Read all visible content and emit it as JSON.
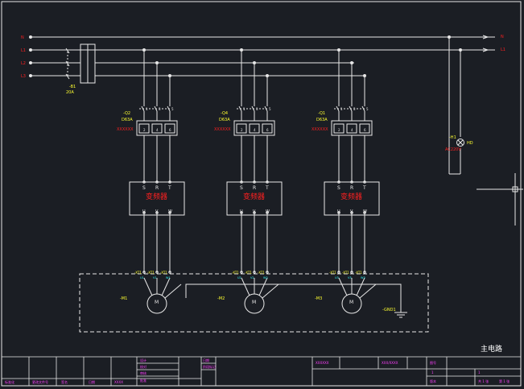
{
  "colors": {
    "background": "#1b1e24",
    "line": "#e8e8e8",
    "label_red": "#ff2020",
    "label_yellow": "#ffff30",
    "label_magenta": "#ff40ff",
    "label_cyan": "#30ffff",
    "label_green": "#30ff30"
  },
  "bus": {
    "left_labels": [
      "N",
      "L1",
      "L2",
      "L3"
    ],
    "right_labels": [
      "N",
      "L1"
    ]
  },
  "main_breaker": {
    "id": "-B1",
    "rating": "20A"
  },
  "drives": [
    {
      "breaker_id": "-Q2",
      "breaker_rating": "D63A",
      "breaker_model": "XXXXXX",
      "contacts": [
        "1",
        "3",
        "5"
      ],
      "contact_bottom": [
        "2",
        "4",
        "6"
      ],
      "vfd_label": "变频器",
      "input_terms": [
        "S",
        "R",
        "T"
      ],
      "output_terms": [
        "U",
        "V",
        "W"
      ],
      "terminal_ids": [
        "-XT1",
        "-XT1",
        "-XT1"
      ],
      "terminal_nums": [
        "U1",
        "V1",
        "W1"
      ],
      "motor_id": "-M1",
      "motor_symbol": "M"
    },
    {
      "breaker_id": "-Q4",
      "breaker_rating": "D63A",
      "breaker_model": "XXXXXX",
      "contacts": [
        "1",
        "3",
        "5"
      ],
      "contact_bottom": [
        "2",
        "4",
        "6"
      ],
      "vfd_label": "变频器",
      "input_terms": [
        "S",
        "R",
        "T"
      ],
      "output_terms": [
        "U",
        "V",
        "W"
      ],
      "terminal_ids": [
        "-XT1",
        "-XT1",
        "-XT1"
      ],
      "terminal_nums": [
        "U2",
        "V2",
        "W2"
      ],
      "motor_id": "-M2",
      "motor_symbol": "M"
    },
    {
      "breaker_id": "-Q1",
      "breaker_rating": "D63A",
      "breaker_model": "XXXXXX",
      "contacts": [
        "1",
        "3",
        "5"
      ],
      "contact_bottom": [
        "2",
        "4",
        "6"
      ],
      "vfd_label": "变频器",
      "input_terms": [
        "S",
        "R",
        "T"
      ],
      "output_terms": [
        "U",
        "V",
        "W"
      ],
      "terminal_ids": [
        "-XT1",
        "-XT1",
        "-XT1"
      ],
      "terminal_nums": [
        "U3",
        "V3",
        "W3"
      ],
      "motor_id": "-M3",
      "motor_symbol": "M"
    }
  ],
  "indicator": {
    "id": "-H1",
    "spec": "AC220V",
    "label": "HD"
  },
  "ground": {
    "id": "-GND1"
  },
  "title_block": {
    "drawing_title": "主电路",
    "row_labels": [
      "设计",
      "校对",
      "审核",
      "批准",
      "日期"
    ],
    "bottom_cells": [
      "标准化",
      "更改文件号",
      "签名",
      "日期",
      "XXXX"
    ],
    "mid_cells": [
      "阶段标记",
      "重量",
      "比例"
    ],
    "right_cells": [
      "图号",
      "共 1 张",
      "第 1 张",
      "版本"
    ],
    "code_left": "XXXXXX",
    "code_mid": "XXX/XXXX",
    "sheet_marks": [
      "1",
      "1",
      "1",
      "1"
    ]
  }
}
